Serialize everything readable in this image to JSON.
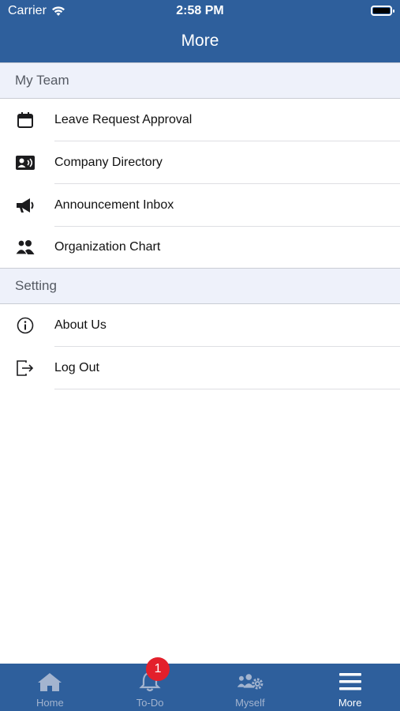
{
  "status_bar": {
    "carrier": "Carrier",
    "time": "2:58 PM"
  },
  "header": {
    "title": "More"
  },
  "sections": [
    {
      "title": "My Team",
      "items": [
        {
          "label": "Leave Request Approval",
          "icon": "calendar-icon"
        },
        {
          "label": "Company Directory",
          "icon": "contact-card-icon"
        },
        {
          "label": "Announcement Inbox",
          "icon": "megaphone-icon"
        },
        {
          "label": "Organization Chart",
          "icon": "people-icon"
        }
      ]
    },
    {
      "title": "Setting",
      "items": [
        {
          "label": "About Us",
          "icon": "info-icon"
        },
        {
          "label": "Log Out",
          "icon": "logout-icon"
        }
      ]
    }
  ],
  "tab_bar": {
    "tabs": [
      {
        "label": "Home",
        "icon": "home-icon",
        "active": false
      },
      {
        "label": "To-Do",
        "icon": "bell-icon",
        "active": false,
        "badge": "1"
      },
      {
        "label": "Myself",
        "icon": "users-gear-icon",
        "active": false
      },
      {
        "label": "More",
        "icon": "menu-icon",
        "active": true
      }
    ]
  },
  "colors": {
    "primary": "#2e5f9c",
    "section_bg": "#eef1fa",
    "badge": "#e3202b",
    "inactive_tab": "#a3b4cf"
  }
}
